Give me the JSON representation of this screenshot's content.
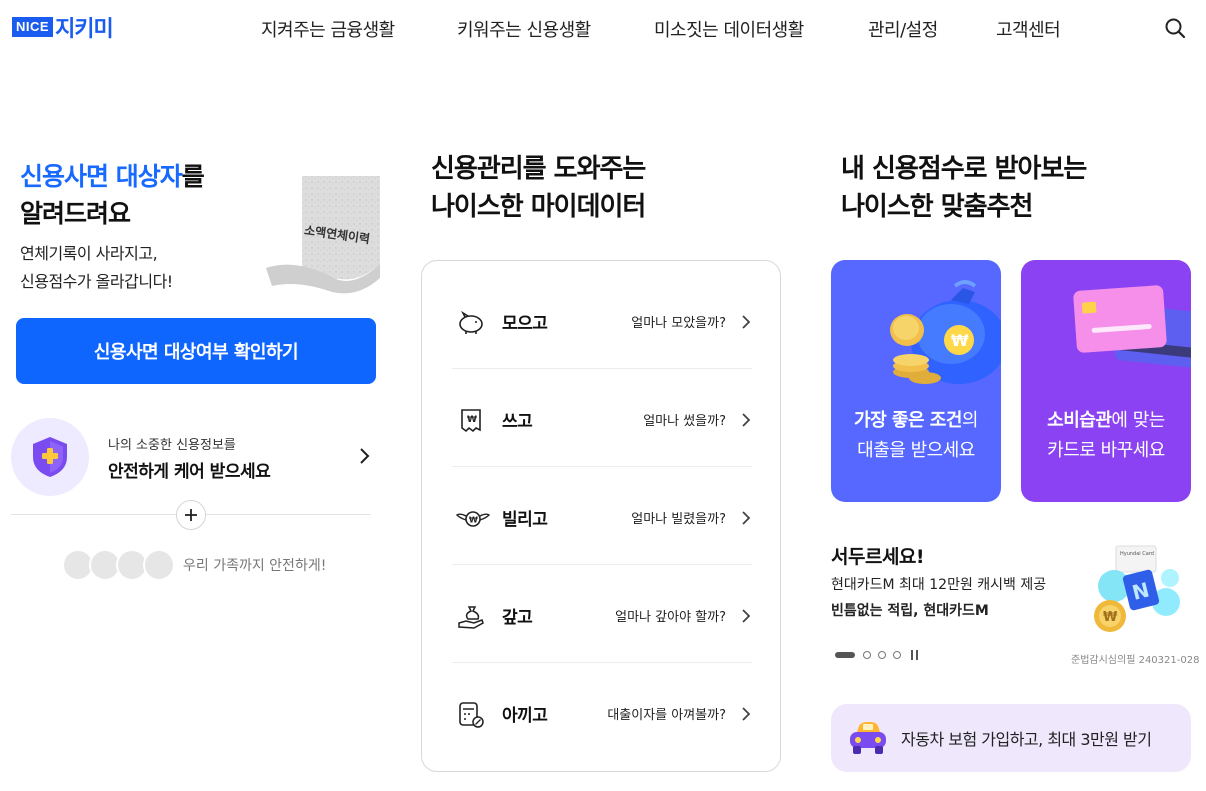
{
  "brand": {
    "badge": "NICE",
    "name": "지키미"
  },
  "nav": [
    {
      "label": "지켜주는 금융생활"
    },
    {
      "label": "키워주는 신용생활"
    },
    {
      "label": "미소짓는 데이터생활"
    },
    {
      "label": "관리/설정"
    },
    {
      "label": "고객센터"
    }
  ],
  "left": {
    "title_accent": "신용사면 대상자",
    "title_rest": "를",
    "title_line2": "알려드려요",
    "sub_line1": "연체기록이 사라지고,",
    "sub_line2": "신용점수가 올라갑니다!",
    "receipt_text": "소액연체이력",
    "button": "신용사면 대상여부 확인하기",
    "care_small": "나의 소중한 신용정보를",
    "care_big": "안전하게 케어 받으세요",
    "family_text": "우리 가족까지 안전하게!"
  },
  "middle": {
    "title_line1": "신용관리를 도와주는",
    "title_line2": "나이스한 마이데이터",
    "rows": [
      {
        "label": "모으고",
        "question": "얼마나 모았을까?",
        "icon": "piggy-bank-icon"
      },
      {
        "label": "쓰고",
        "question": "얼마나 썼을까?",
        "icon": "receipt-icon"
      },
      {
        "label": "빌리고",
        "question": "얼마나 빌렸을까?",
        "icon": "winged-coin-icon"
      },
      {
        "label": "갚고",
        "question": "얼마나 갚아야 할까?",
        "icon": "hand-moneybag-icon"
      },
      {
        "label": "아끼고",
        "question": "대출이자를 아껴볼까?",
        "icon": "calculator-icon"
      }
    ]
  },
  "right": {
    "title_line1": "내 신용점수로 받아보는",
    "title_line2": "나이스한 맞춤추천",
    "promo_loan": {
      "bold": "가장 좋은 조건",
      "rest": "의",
      "line2": "대출을 받으세요"
    },
    "promo_card": {
      "bold": "소비습관",
      "rest": "에 맞는",
      "line2": "카드로 바꾸세요"
    },
    "ad": {
      "title": "서두르세요!",
      "line1": "현대카드M 최대 12만원 캐시백 제공",
      "line2": "빈틈없는 적립, 현대카드M",
      "card_label": "Hyundai Card",
      "code": "준법감시심의필 240321-028"
    },
    "car_banner": "자동차 보험 가입하고, 최대 3만원 받기"
  },
  "colors": {
    "brand_blue": "#1769ff",
    "promo_blue": "#5668ff",
    "promo_purple": "#8b42f2",
    "banner_lilac": "#efe8fd"
  }
}
